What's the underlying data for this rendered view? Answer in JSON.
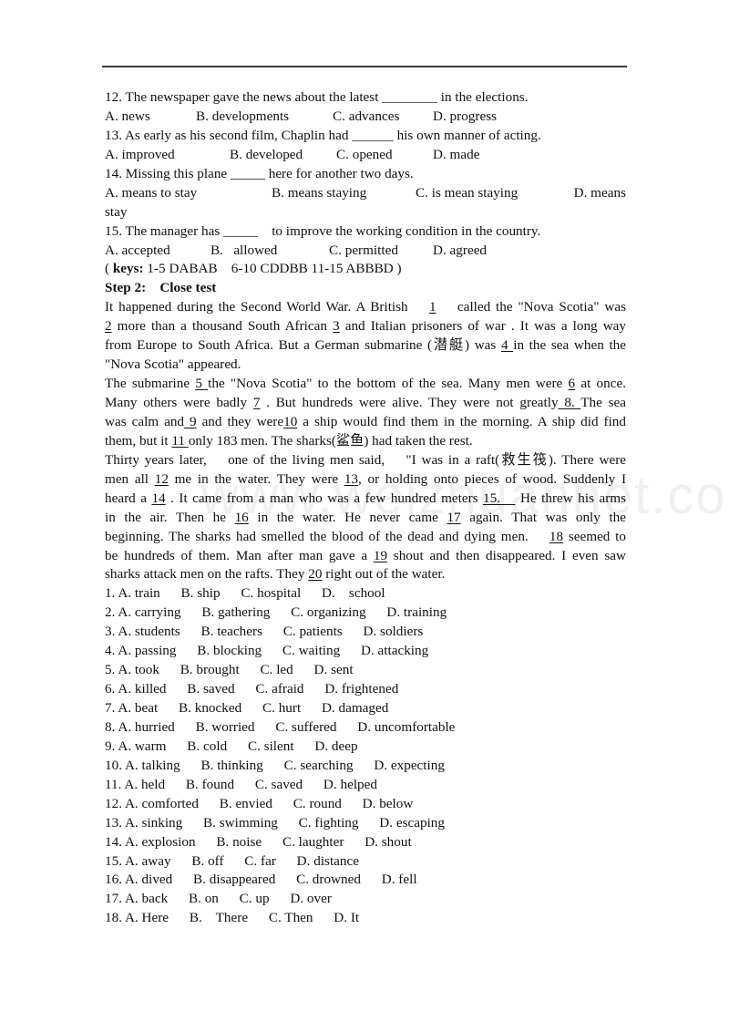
{
  "questions_part1": [
    {
      "stem": "12. The newspaper gave the news about the latest ________ in the elections.",
      "options": [
        "A. news",
        "B. developments",
        "C. advances",
        "D. progress"
      ]
    },
    {
      "stem": "13. As early as his second film, Chaplin had ______ his own manner of acting.",
      "options": [
        "A. improved",
        "B. developed",
        "C. opened",
        "D. made"
      ]
    },
    {
      "stem": "14. Missing this plane _____ here for another two days.",
      "options": [
        "A. means to stay",
        "B. means staying",
        "C. is mean staying",
        "D. means"
      ],
      "wrap": "stay"
    },
    {
      "stem": "15. The manager has _____    to improve the working condition in the country.",
      "options": [
        "A. accepted",
        "B.   allowed",
        "C. permitted",
        "D. agreed"
      ]
    }
  ],
  "keys": {
    "prefix": "( ",
    "label": "keys:",
    "text": " 1-5 DABAB    6-10 CDDBB 11-15 ABBBD )"
  },
  "step2_heading": "Step 2:    Close test",
  "passage": {
    "p1": [
      [
        "It happened during the Second World War. A British    ",
        {
          "u": "1"
        },
        "    called the \"Nova Scotia\" was"
      ],
      [
        {
          "u": "2"
        },
        " more than a thousand South African ",
        {
          "u": "3"
        },
        " and Italian prisoners of war . It was a long way"
      ],
      [
        "from Europe to South Africa. But a German submarine (潜艇) was ",
        {
          "u": "4 "
        },
        "in the sea when the"
      ],
      [
        "\"Nova Scotia\" appeared."
      ]
    ],
    "p2": [
      [
        "The submarine ",
        {
          "u": "5 "
        },
        "the \"Nova Scotia\" to the bottom of the sea. Many men were ",
        {
          "u": "6"
        },
        " at once."
      ],
      [
        "Many others were badly ",
        {
          "u": "7"
        },
        " . But hundreds were alive. They were not greatly",
        {
          "u": " 8. "
        },
        "The sea"
      ],
      [
        "was calm and",
        {
          "u": " 9"
        },
        " and they were",
        {
          "u": "10"
        },
        " a ship would find them in the morning. A ship did find"
      ],
      [
        "them, but it ",
        {
          "u": "11 "
        },
        "only 183 men. The sharks(鲨鱼) had taken the rest."
      ]
    ],
    "p3": [
      [
        "Thirty years later,    one of the living men said,    \"I was in a raft(救生筏). There were"
      ],
      [
        "men all ",
        {
          "u": "12"
        },
        " me in the water. They were ",
        {
          "u": "13"
        },
        ", or holding onto pieces of wood. Suddenly I"
      ],
      [
        "heard a ",
        {
          "u": "14"
        },
        " . It came from a man who was a few hundred meters ",
        {
          "u": "15.   "
        },
        " He threw his arms"
      ],
      [
        "in the air. Then he ",
        {
          "u": "16"
        },
        " in the water. He never came ",
        {
          "u": "17"
        },
        " again. That was only the"
      ],
      [
        "beginning. The sharks had smelled the blood of the dead and dying men.    ",
        {
          "u": "18"
        },
        " seemed to"
      ],
      [
        "be hundreds of them. Man after man gave a ",
        {
          "u": "19"
        },
        " shout and then disappeared. I even saw"
      ],
      [
        "sharks attack men on the rafts. They ",
        {
          "u": "20"
        },
        " right out of the water."
      ]
    ]
  },
  "cloze_options": [
    {
      "num": "1.",
      "options": [
        "A. train",
        "B. ship",
        "C. hospital",
        "D.    school"
      ]
    },
    {
      "num": "2.",
      "options": [
        "A. carrying",
        "B. gathering",
        "C. organizing",
        "D. training"
      ]
    },
    {
      "num": "3.",
      "options": [
        "A. students",
        "B. teachers",
        "C. patients",
        "D. soldiers"
      ]
    },
    {
      "num": "4.",
      "options": [
        "A. passing",
        "B. blocking",
        "C. waiting",
        "D. attacking"
      ]
    },
    {
      "num": "5.",
      "options": [
        "A. took",
        "B. brought",
        "C. led",
        "D. sent"
      ]
    },
    {
      "num": "6.",
      "options": [
        "A. killed",
        "B. saved",
        "C. afraid",
        "D. frightened"
      ]
    },
    {
      "num": "7.",
      "options": [
        "A. beat",
        "B. knocked",
        "C. hurt",
        "D. damaged"
      ]
    },
    {
      "num": "8.",
      "options": [
        "A. hurried",
        "B. worried",
        "C. suffered",
        "D. uncomfortable"
      ]
    },
    {
      "num": "9.",
      "options": [
        "A. warm",
        "B. cold",
        "C. silent",
        "D. deep"
      ]
    },
    {
      "num": "10.",
      "options": [
        "A. talking",
        "B. thinking",
        "C. searching",
        "D. expecting"
      ]
    },
    {
      "num": "11.",
      "options": [
        "A. held",
        "B. found",
        "C. saved",
        "D. helped"
      ]
    },
    {
      "num": "12.",
      "options": [
        "A. comforted",
        "B. envied",
        "C. round",
        "D. below"
      ]
    },
    {
      "num": "13.",
      "options": [
        "A. sinking",
        "B. swimming",
        "C. fighting",
        "D. escaping"
      ]
    },
    {
      "num": "14.",
      "options": [
        "A. explosion",
        "B. noise",
        "C. laughter",
        "D. shout"
      ]
    },
    {
      "num": "15.",
      "options": [
        "A. away",
        "B. off",
        "C. far",
        "D. distance"
      ]
    },
    {
      "num": "16.",
      "options": [
        "A. dived",
        "B. disappeared",
        "C. drowned",
        "D. fell"
      ]
    },
    {
      "num": "17.",
      "options": [
        "A. back",
        "B. on",
        "C. up",
        "D. over"
      ]
    },
    {
      "num": "18.",
      "options": [
        "A. Here",
        "B.    There",
        "C. Then",
        "D. It"
      ]
    }
  ],
  "watermark": "www.weizhuannet.com"
}
